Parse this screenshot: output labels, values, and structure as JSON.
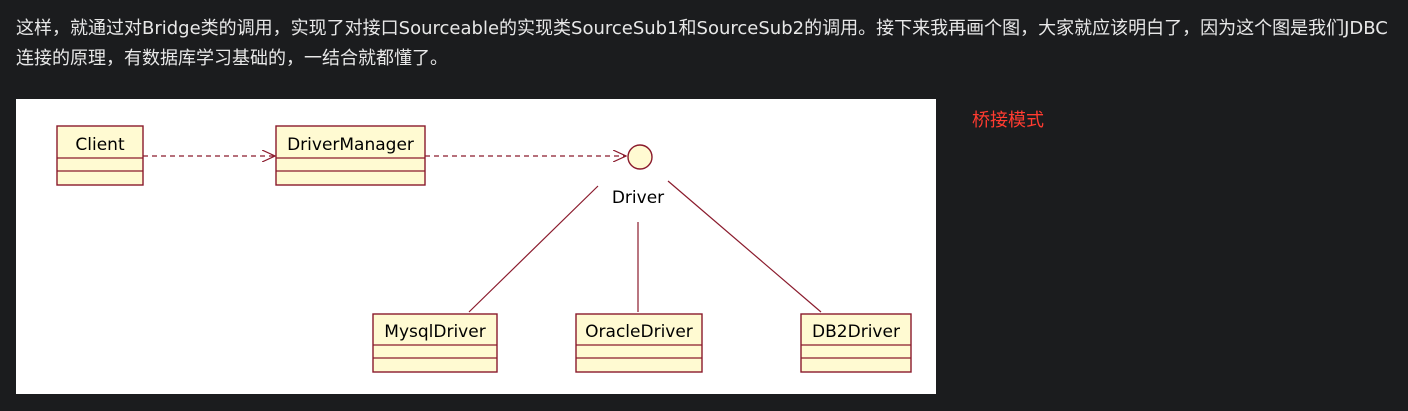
{
  "article": {
    "paragraph": "这样，就通过对Bridge类的调用，实现了对接口Sourceable的实现类SourceSub1和SourceSub2的调用。接下来我再画个图，大家就应该明白了，因为这个图是我们JDBC连接的原理，有数据库学习基础的，一结合就都懂了。",
    "side_label": "桥接模式"
  },
  "diagram": {
    "classes": {
      "client": "Client",
      "driver_manager": "DriverManager",
      "mysql": "MysqlDriver",
      "oracle": "OracleDriver",
      "db2": "DB2Driver"
    },
    "interface_label": "Driver"
  },
  "colors": {
    "page_background": "#1b1c1e",
    "side_label": "#ff3b30",
    "class_fill": "#fffad2",
    "class_border": "#8a1a2c"
  }
}
